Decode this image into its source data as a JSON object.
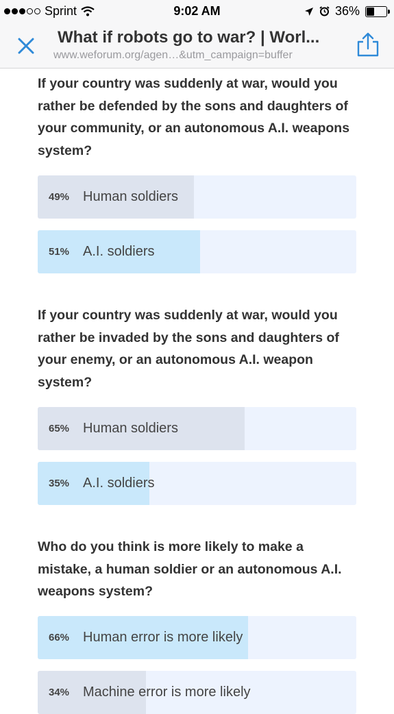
{
  "status_bar": {
    "carrier": "Sprint",
    "time": "9:02 AM",
    "battery": "36%",
    "signal_bars_filled": 3,
    "battery_level": 0.36
  },
  "nav": {
    "title": "What if robots go to war? | Worl...",
    "url": "www.weforum.org/agen…&utm_campaign=buffer",
    "close_icon": "close-icon",
    "share_icon": "share-icon"
  },
  "colors": {
    "chosen_fill": "#c9e8fb",
    "other_fill": "#dde3ee",
    "track": "#edf3fe",
    "accent": "#2f8ad8"
  },
  "polls": [
    {
      "question": "If your country was suddenly at war, would you rather be defended by the sons and daughters of your community, or an autonomous A.I. weapons system?",
      "options": [
        {
          "percent_label": "49%",
          "label": "Human soldiers",
          "value": 49,
          "chosen": false
        },
        {
          "percent_label": "51%",
          "label": "A.I. soldiers",
          "value": 51,
          "chosen": true
        }
      ]
    },
    {
      "question": "If your country was suddenly at war, would you rather be invaded by the sons and daughters of your enemy, or an autonomous A.I. weapon system?",
      "options": [
        {
          "percent_label": "65%",
          "label": "Human soldiers",
          "value": 65,
          "chosen": false
        },
        {
          "percent_label": "35%",
          "label": "A.I. soldiers",
          "value": 35,
          "chosen": true
        }
      ]
    },
    {
      "question": "Who do you think is more likely to make a mistake, a human soldier or an autonomous A.I. weapons system?",
      "options": [
        {
          "percent_label": "66%",
          "label": "Human error is more likely",
          "value": 66,
          "chosen": true
        },
        {
          "percent_label": "34%",
          "label": "Machine error is more likely",
          "value": 34,
          "chosen": false
        }
      ]
    }
  ]
}
